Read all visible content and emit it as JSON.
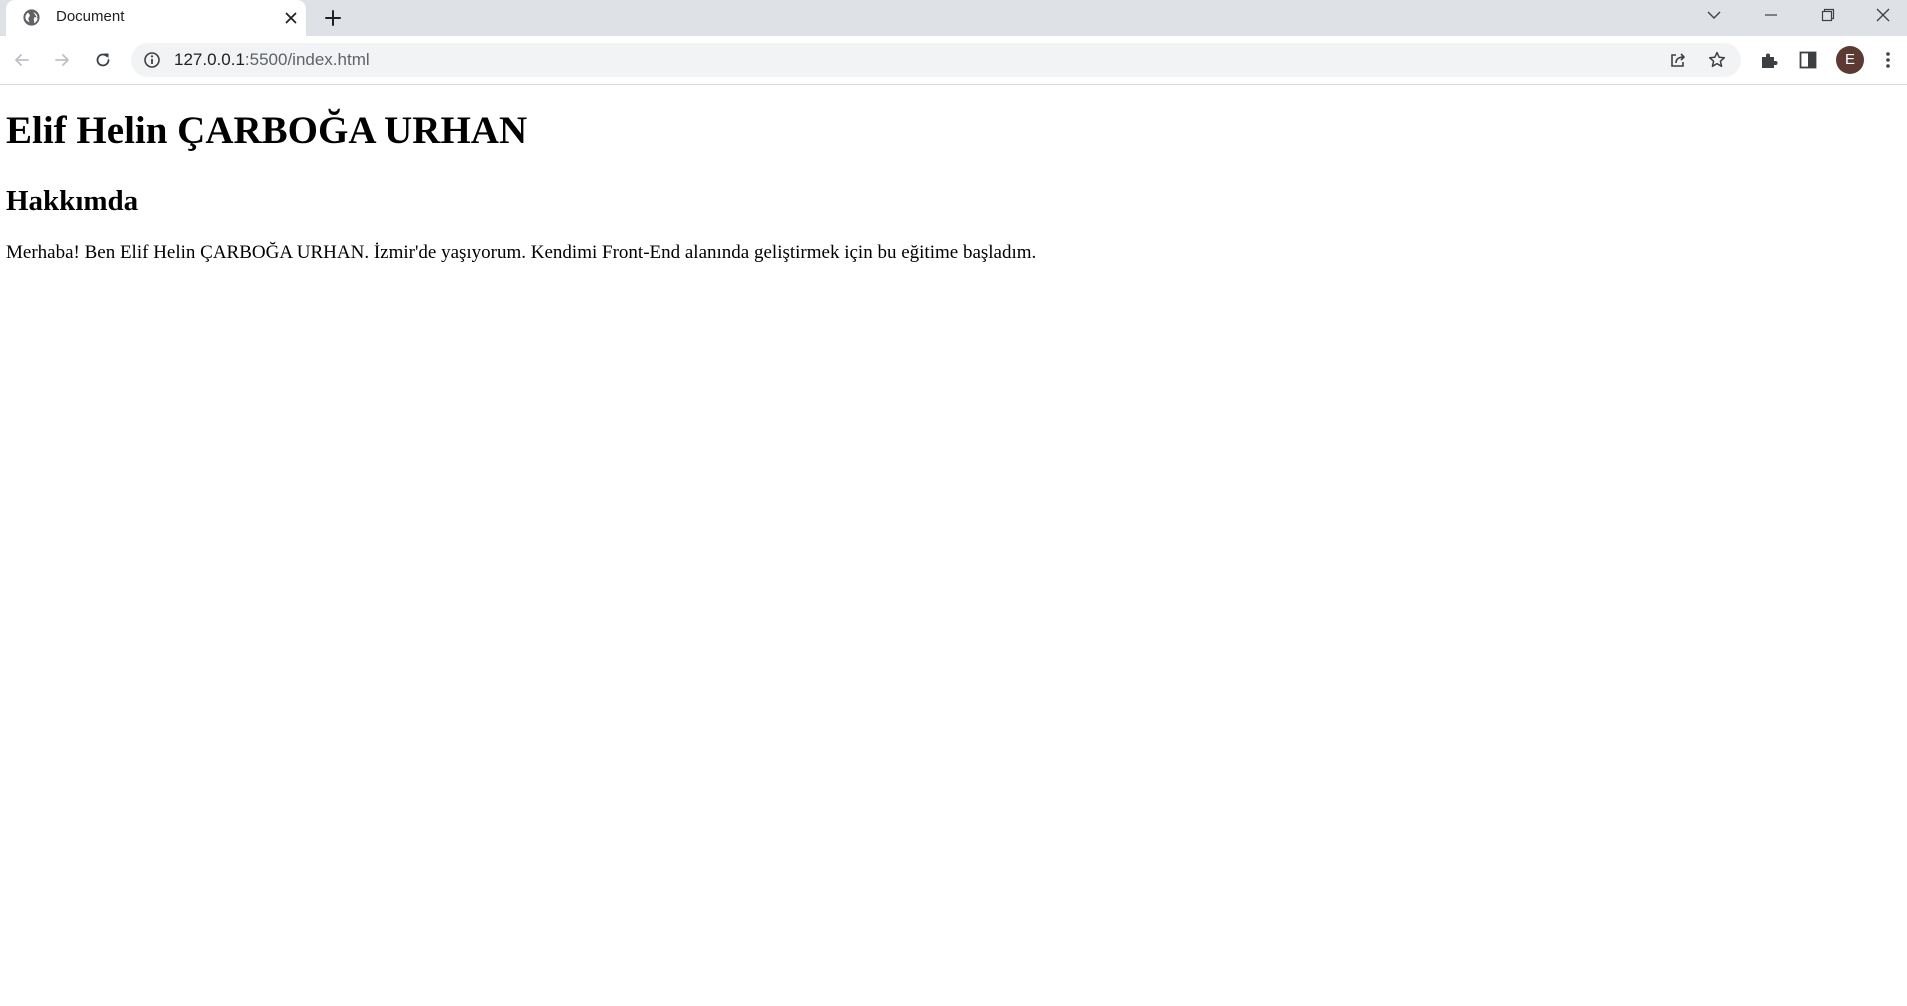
{
  "browser": {
    "tab": {
      "title": "Document",
      "favicon": "globe-icon"
    },
    "address_bar": {
      "host": "127.0.0.1",
      "path": ":5500/index.html"
    },
    "profile_initial": "E",
    "colors": {
      "tabstrip": "#dee1e6",
      "omnibox": "#f1f3f4",
      "avatar": "#5c3a33"
    }
  },
  "page": {
    "heading": "Elif Helin ÇARBOĞA URHAN",
    "section_title": "Hakkımda",
    "paragraph": "Merhaba! Ben Elif Helin ÇARBOĞA URHAN. İzmir'de yaşıyorum. Kendimi Front-End alanında geliştirmek için bu eğitime başladım."
  }
}
